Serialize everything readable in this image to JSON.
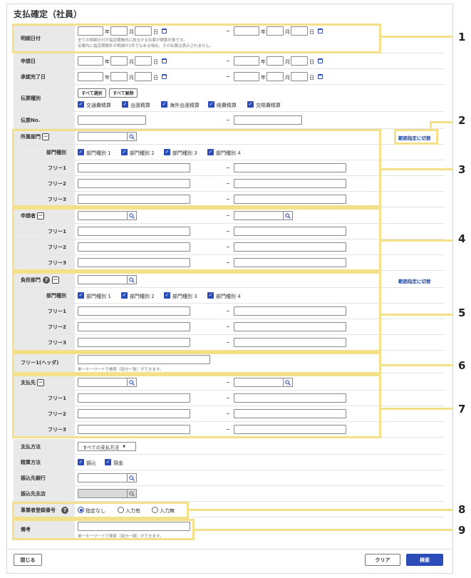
{
  "page": {
    "title": "支払確定（社員）"
  },
  "labels": {
    "meisai_date": "明細日付",
    "apply_date": "申請日",
    "approve_date": "承認完了日",
    "denpyo_type": "伝票種別",
    "denpyo_no": "伝票No.",
    "dept": "所属部門",
    "dept_type": "部門種別",
    "free1": "フリー1",
    "free2": "フリー2",
    "free3": "フリー3",
    "applicant": "申請者",
    "burden_dept": "負担部門",
    "free1_header": "フリー1(ヘッダ)",
    "payee": "支払先",
    "pay_method": "支払方法",
    "settle_method": "精算方法",
    "bank": "振込先銀行",
    "branch": "振込先支店",
    "reg_no": "事業者登録番号",
    "remarks": "備考"
  },
  "date": {
    "year": "年",
    "month": "月",
    "day": "日",
    "tilde": "~"
  },
  "hints": {
    "meisai1": "全ての明細日付が指定期間内に該当する伝票が検索対象です。",
    "meisai2": "伝票内に指定期間外の明細が1件でもある場合、その伝票は表示されません。",
    "keyword": "単一キーワードで検索（部分一致）ができます。"
  },
  "buttons": {
    "select_all": "すべて選択",
    "clear_all": "すべて解除",
    "close": "閉じる",
    "clear": "クリア",
    "search": "検索",
    "range_switch": "範囲指定に切替"
  },
  "denpyo_types": [
    "交通費精算",
    "出張精算",
    "海外出張精算",
    "経費精算",
    "交際費精算"
  ],
  "dept_types": [
    "部門種別 1",
    "部門種別 2",
    "部門種別 3",
    "部門種別 4"
  ],
  "pay_method_select": "すべての支払方法",
  "settle_methods": [
    "振込",
    "現金"
  ],
  "reg_options": [
    "指定なし",
    "入力有",
    "入力無"
  ],
  "callouts": [
    "1",
    "2",
    "3",
    "4",
    "5",
    "6",
    "7",
    "8",
    "9"
  ],
  "colors": {
    "accent": "#2a4bb8",
    "highlight": "#f5e08a",
    "label_bg": "#e9e9e9"
  }
}
